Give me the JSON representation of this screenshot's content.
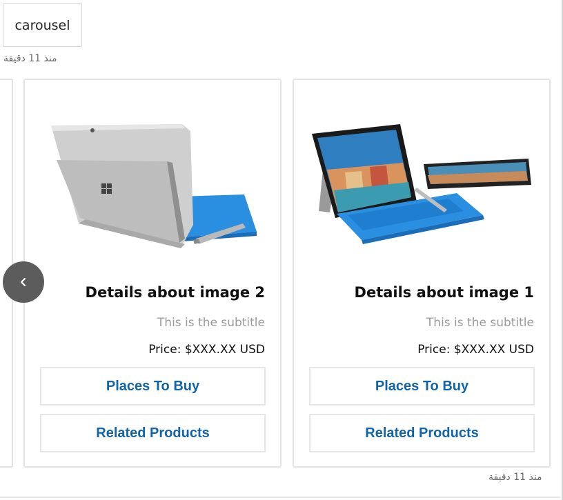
{
  "header": {
    "chip_label": "carousel",
    "timestamp_top": "منذ 11 دقيقة"
  },
  "carousel": {
    "cards": [
      {
        "title": "Details about image 1",
        "subtitle": "This is the subtitle",
        "price": "Price: $XXX.XX USD",
        "buttons": {
          "buy": "Places To Buy",
          "related": "Related Products"
        }
      },
      {
        "title": "Details about image 2",
        "subtitle": "This is the subtitle",
        "price": "Price: $XXX.XX USD",
        "buttons": {
          "buy": "Places To Buy",
          "related": "Related Products"
        }
      }
    ],
    "prev_icon": "chevron-left-icon"
  },
  "footer": {
    "timestamp_bottom": "منذ 11 دقيقة"
  },
  "colors": {
    "accent": "#1264a8",
    "arrow_bg": "#5c5c5c",
    "keyboard_blue": "#2a8fe0"
  }
}
